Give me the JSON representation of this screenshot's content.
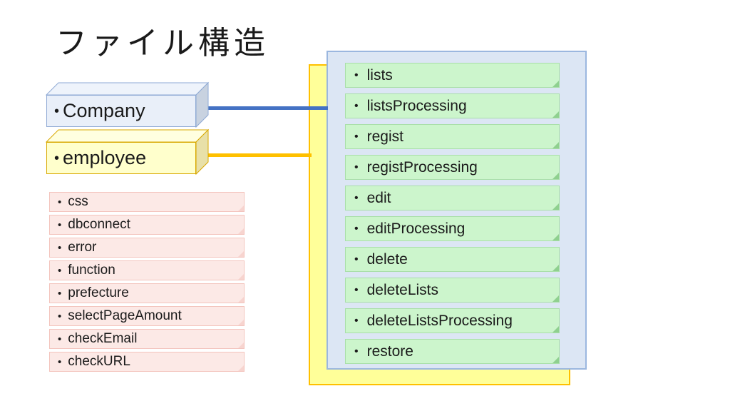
{
  "slide": {
    "title": "ファイル構造",
    "background_color": "#ffffff"
  },
  "entities": [
    {
      "name": "Company",
      "bullet": "•",
      "fill_color": "#e9eff9",
      "border_color": "#8ea9d4",
      "connector_color": "#4472c4"
    },
    {
      "name": "employee",
      "bullet": "•",
      "fill_color": "#ffffcc",
      "border_color": "#d8a800",
      "connector_color": "#ffc000"
    }
  ],
  "common_files": {
    "bullet": "•",
    "fill_color": "#fce9e6",
    "border_color": "#f3c4bd",
    "items": [
      "css",
      "dbconnect",
      "error",
      "function",
      "prefecture",
      "selectPageAmount",
      "checkEmail",
      "checkURL"
    ]
  },
  "panels": {
    "yellow_panel": {
      "fill_color": "#ffff99",
      "border_color": "#ffc000"
    },
    "blue_panel": {
      "fill_color": "#dce6f4",
      "border_color": "#9bb7df"
    }
  },
  "page_files": {
    "bullet": "•",
    "fill_color": "#ccf5cc",
    "border_color": "#a9dfa9",
    "items": [
      "lists",
      "listsProcessing",
      "regist",
      "registProcessing",
      "edit",
      "editProcessing",
      "delete",
      "deleteLists",
      "deleteListsProcessing",
      "restore"
    ]
  }
}
